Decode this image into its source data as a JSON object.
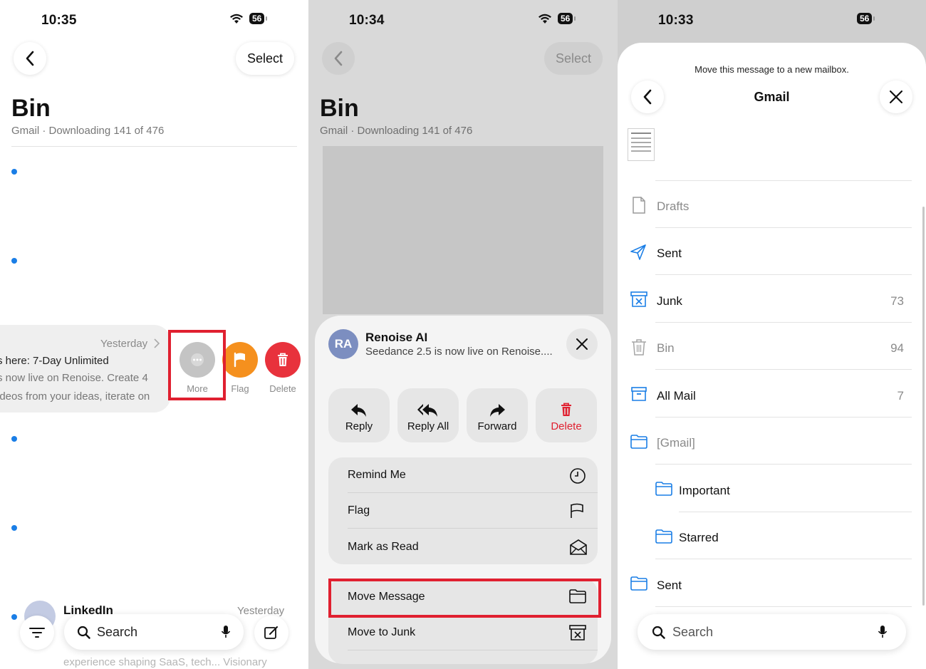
{
  "panel1": {
    "status": {
      "time": "10:35",
      "battery": "56"
    },
    "select_label": "Select",
    "title": "Bin",
    "subtitle": "Gmail · Downloading 141 of 476",
    "swiped_row": {
      "date": "Yesterday",
      "line1": "s here: 7-Day Unlimited",
      "line2": "s now live on Renoise. Create 4",
      "line3": "ideos from your ideas, iterate on"
    },
    "actions": {
      "more": "More",
      "flag": "Flag",
      "delete": "Delete"
    },
    "bottom_row": {
      "sender": "LinkedIn",
      "date": "Yesterday",
      "preview": "experience shaping SaaS, tech... Visionary"
    },
    "search_label": "Search"
  },
  "panel2": {
    "status": {
      "time": "10:34",
      "battery": "56"
    },
    "select_label": "Select",
    "title": "Bin",
    "subtitle": "Gmail · Downloading 141 of 476",
    "sheet": {
      "avatar_initials": "RA",
      "sender": "Renoise AI",
      "preview": "Seedance 2.5 is now live on Renoise....",
      "quick_actions": [
        "Reply",
        "Reply All",
        "Forward",
        "Delete"
      ],
      "menu1": [
        "Remind Me",
        "Flag",
        "Mark as Read"
      ],
      "menu2": [
        "Move Message",
        "Move to Junk"
      ]
    }
  },
  "panel3": {
    "status": {
      "time": "10:33",
      "battery": "56"
    },
    "prompt": "Move this message to a new mailbox.",
    "title": "Gmail",
    "mailboxes": [
      {
        "label": "Drafts",
        "count": "",
        "icon": "draft-icon"
      },
      {
        "label": "Sent",
        "count": "",
        "icon": "paperplane-icon"
      },
      {
        "label": "Junk",
        "count": "73",
        "icon": "junk-icon"
      },
      {
        "label": "Bin",
        "count": "94",
        "icon": "trash-icon"
      },
      {
        "label": "All Mail",
        "count": "7",
        "icon": "archive-icon"
      },
      {
        "label": "[Gmail]",
        "count": "",
        "icon": "folder-icon"
      },
      {
        "label": "Important",
        "count": "",
        "icon": "folder-icon"
      },
      {
        "label": "Starred",
        "count": "",
        "icon": "folder-icon"
      },
      {
        "label": "Sent",
        "count": "",
        "icon": "folder-icon"
      }
    ],
    "search_label": "Search"
  },
  "colors": {
    "accent": "#1a7ee6",
    "flag": "#f5901e",
    "delete": "#e8323c",
    "highlight": "#e02030"
  }
}
